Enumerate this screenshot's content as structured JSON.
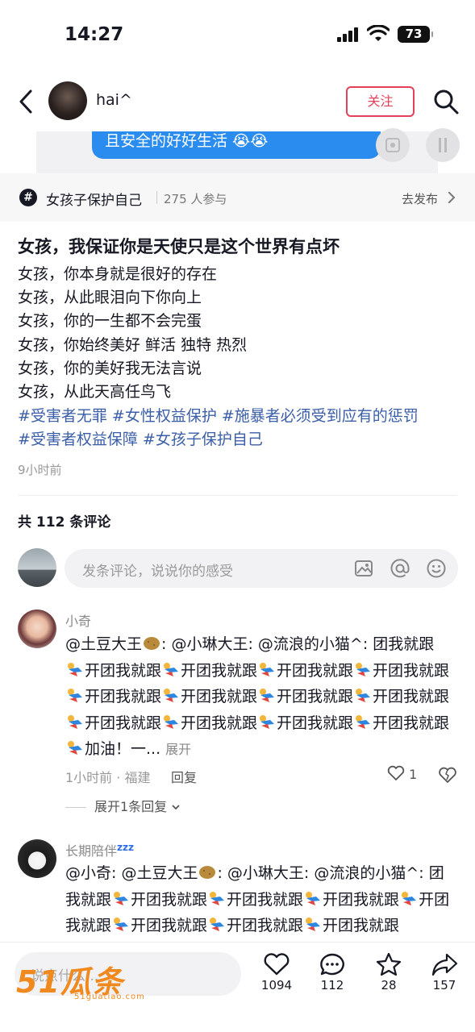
{
  "status_bar": {
    "time": "14:27",
    "battery": "73"
  },
  "header": {
    "username": "hai^",
    "follow_label": "关注"
  },
  "media": {
    "caption": "且安全的好好生活 😭😭"
  },
  "topic": {
    "name": "女孩子保护自己",
    "participants": "275 人参与",
    "action": "去发布"
  },
  "post": {
    "title": "女孩，我保证你是天使只是这个世界有点坏",
    "lines": [
      "女孩，你本身就是很好的存在",
      "女孩，从此眼泪向下你向上",
      "女孩，你的一生都不会完蛋",
      "女孩，你始终美好 鲜活 独特 热烈",
      "女孩，你的美好我无法言说",
      "女孩，从此天高任鸟飞"
    ],
    "tags": [
      "#受害者无罪",
      "#女性权益保护",
      "#施暴者必须受到应有的惩罚",
      "#受害者权益保障",
      "#女孩子保护自己"
    ],
    "time": "9小时前"
  },
  "comments_header": "共 112 条评论",
  "comment_input": {
    "placeholder": "发条评论，说说你的感受"
  },
  "comments": [
    {
      "user": "小奇",
      "text_start": "@土豆大王",
      "text_mid": ": @小琳大王: @流浪的小猫^: 团我就跟",
      "segments": [
        "开团我就跟",
        "开团我就跟",
        "开团我就跟",
        "开团我就跟",
        "开团我就跟",
        "开团我就跟",
        "开团我就跟",
        "开团我就跟",
        "开团我就跟",
        "开团我就跟",
        "开团我就跟",
        "开团我就跟"
      ],
      "tail": "加油！一...",
      "expand": "展开",
      "meta": "1小时前 · 福建",
      "reply": "回复",
      "likes": "1",
      "more_replies": "展开1条回复"
    },
    {
      "user": "长期陪伴",
      "user_suffix": "zzz",
      "text_start": "@小奇: @土豆大王",
      "text_mid": ": @小琳大王: @流浪的小猫^: 团我就跟",
      "segments": [
        "开团我就跟",
        "开团我就跟",
        "开团我就跟",
        "开团我就跟",
        "开团我就跟",
        "开团我就跟",
        "开团我就跟"
      ]
    }
  ],
  "bottom_bar": {
    "placeholder": "说点什么...",
    "watermark": "51瓜条",
    "watermark_sub": "51guatiao.com",
    "likes": "1094",
    "comments": "112",
    "favorites": "28",
    "shares": "157"
  }
}
